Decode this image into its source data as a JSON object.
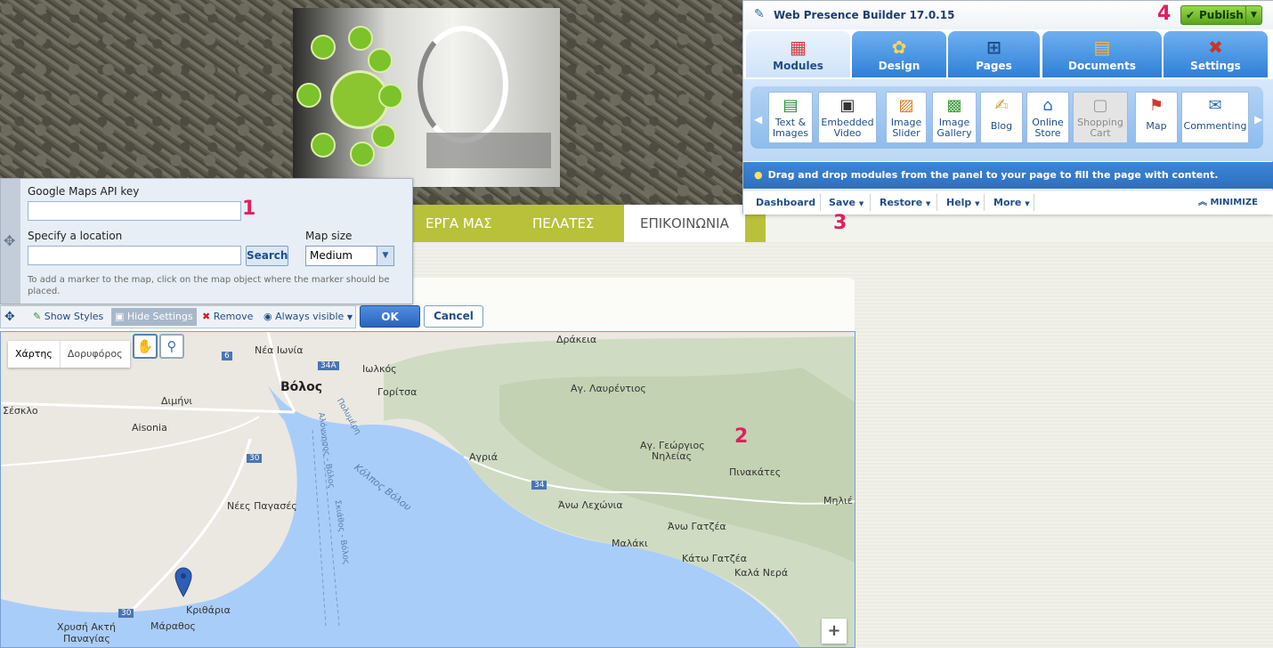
{
  "nav": {
    "items": [
      "ΕΡΓΑ ΜΑΣ",
      "ΠΕΛΑΤΕΣ",
      "ΕΠΙΚΟΙΝΩΝΙΑ"
    ]
  },
  "settings": {
    "api_key_label": "Google Maps API key",
    "api_key_value": "",
    "location_label": "Specify a location",
    "location_value": "",
    "search_label": "Search",
    "map_size_label": "Map size",
    "map_size_value": "Medium",
    "hint": "To add a marker to the map, click on the map object where the marker should be placed."
  },
  "toolbar": {
    "show_styles": "Show Styles",
    "hide_settings": "Hide Settings",
    "remove": "Remove",
    "always_visible": "Always visible",
    "ok": "OK",
    "cancel": "Cancel"
  },
  "map": {
    "types": [
      "Χάρτης",
      "Δορυφόρος"
    ],
    "zoom_in": "+",
    "places": {
      "nea_ionia": "Νέα Ιωνία",
      "volos": "Βόλος",
      "iolkos": "Ιωλκός",
      "goritsa": "Γορίτσα",
      "sesklo": "Σέσκλο",
      "dimini": "Διμήνι",
      "aisonia": "Aisonia",
      "nees_pagases": "Νέες Παγασές",
      "kritharia": "Κριθάρια",
      "marathos": "Μάραθος",
      "chrysi_akti": "Χρυσή Ακτή",
      "panagias": "Παναγίας",
      "drakeia": "Δράκεια",
      "ag_lavrentios": "Αγ. Λαυρέντιος",
      "ag_georgios": "Αγ. Γεώργιος",
      "nileias": "Νηλείας",
      "pinakates": "Πινακάτες",
      "agria": "Αγριά",
      "ano_lechonia": "Άνω Λεχώνια",
      "ano_gatzea": "Άνω Γατζέα",
      "malaki": "Μαλάκι",
      "kato_gatzea": "Κάτω Γατζέα",
      "kala_nera": "Καλά Νερά",
      "milies": "Μηλιέ",
      "gulf": "Κόλπος Βόλου",
      "polymeri": "Πολυμέρη",
      "alonysou": "Αλόννησος - Βόλος",
      "skiathos": "Σκιάθος - Βόλος"
    },
    "roads": [
      "6",
      "34A",
      "30",
      "34",
      "30"
    ]
  },
  "annotations": [
    "1",
    "2",
    "3",
    "4"
  ],
  "wpb": {
    "title": "Web Presence Builder 17.0.15",
    "publish": "Publish",
    "tabs": [
      "Modules",
      "Design",
      "Pages",
      "Documents",
      "Settings"
    ],
    "modules": [
      {
        "label1": "Text &",
        "label2": "Images",
        "icon": "text-images-icon"
      },
      {
        "label1": "Embedded",
        "label2": "Video",
        "icon": "video-icon"
      },
      {
        "label1": "Image",
        "label2": "Slider",
        "icon": "slider-icon"
      },
      {
        "label1": "Image",
        "label2": "Gallery",
        "icon": "gallery-icon"
      },
      {
        "label1": "Blog",
        "label2": "",
        "icon": "blog-icon"
      },
      {
        "label1": "Online",
        "label2": "Store",
        "icon": "store-icon"
      },
      {
        "label1": "Shopping",
        "label2": "Cart",
        "icon": "cart-icon"
      },
      {
        "label1": "Map",
        "label2": "",
        "icon": "map-icon"
      },
      {
        "label1": "Commenting",
        "label2": "",
        "icon": "comment-icon"
      }
    ],
    "info": "Drag and drop modules from the panel to your page to fill the page with content.",
    "menu": [
      "Dashboard",
      "Save",
      "Restore",
      "Help",
      "More"
    ],
    "minimize": "MINIMIZE"
  }
}
